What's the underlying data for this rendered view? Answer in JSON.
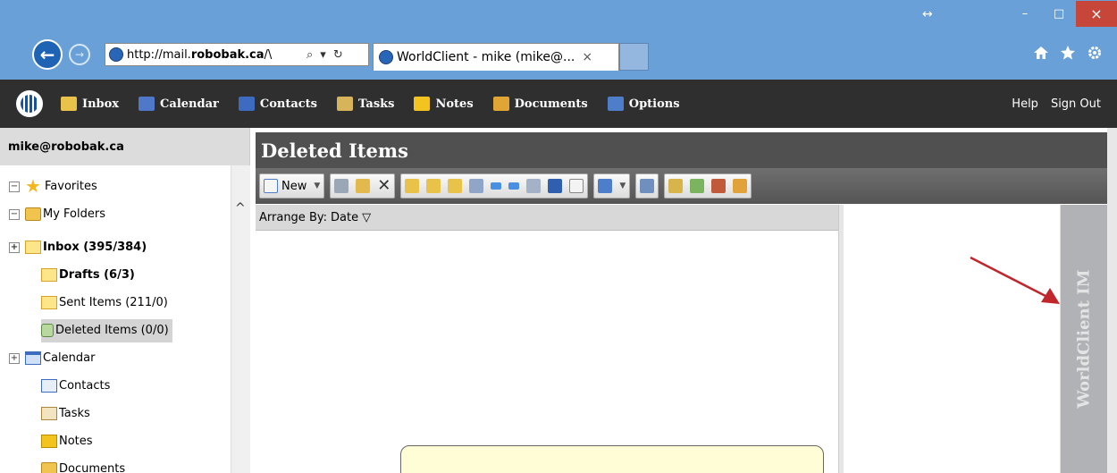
{
  "browser": {
    "back_glyph": "←",
    "fwd_glyph": "→",
    "address_pre": "http://mail.",
    "address_bold": "robobak.ca",
    "address_post": "/\\",
    "address_icons": [
      "⌕",
      "▾",
      "↻"
    ],
    "tab_title": "WorldClient - mike (mike@...",
    "tab_close": "×",
    "window_glyphs": {
      "resize": "↔",
      "minimize": "–",
      "maximize": "□",
      "close": "×"
    },
    "toolbar_icons": [
      "home-icon",
      "star-icon",
      "gear-icon"
    ]
  },
  "nav": {
    "items": [
      {
        "label": "Inbox",
        "color": "#e9c24a"
      },
      {
        "label": "Calendar",
        "color": "#4f78c8"
      },
      {
        "label": "Contacts",
        "color": "#3d6bbf"
      },
      {
        "label": "Tasks",
        "color": "#d7b45a"
      },
      {
        "label": "Notes",
        "color": "#f3c320"
      },
      {
        "label": "Documents",
        "color": "#e0a534"
      },
      {
        "label": "Options",
        "color": "#4e7ec9"
      }
    ],
    "help": "Help",
    "signout": "Sign Out"
  },
  "sidebar": {
    "user": "mike@robobak.ca",
    "scroll_glyph": "^",
    "items": [
      {
        "label": "Favorites",
        "expander": "−"
      },
      {
        "label": "My Folders",
        "expander": "−"
      },
      {
        "label": "Inbox (395/384)",
        "expander": "+"
      },
      {
        "label": "Drafts (6/3)"
      },
      {
        "label": "Sent Items (211/0)"
      },
      {
        "label": "Deleted Items (0/0)"
      },
      {
        "label": "Calendar",
        "expander": "+"
      },
      {
        "label": "Contacts"
      },
      {
        "label": "Tasks"
      },
      {
        "label": "Notes"
      },
      {
        "label": "Documents"
      }
    ]
  },
  "main": {
    "title": "Deleted Items",
    "new_label": "New",
    "delete_glyph": "✕",
    "arrange_label": "Arrange By:",
    "arrange_value": "Date",
    "arrange_glyph": "▽"
  },
  "im": {
    "label": "WorldClient IM"
  },
  "colors": {
    "accent": "#2f2f2f",
    "browser": "#6aa0d8",
    "arrow": "#c0272d"
  }
}
